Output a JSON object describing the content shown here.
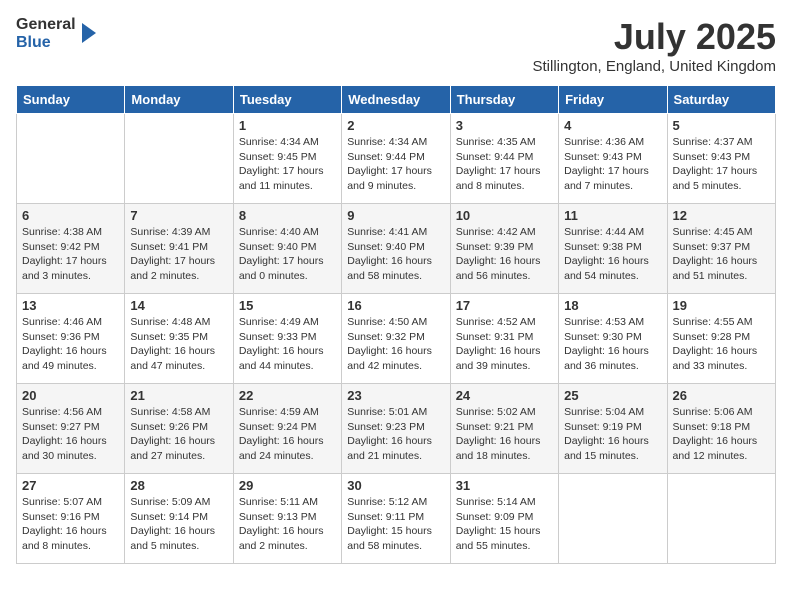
{
  "header": {
    "logo_general": "General",
    "logo_blue": "Blue",
    "month_title": "July 2025",
    "location": "Stillington, England, United Kingdom"
  },
  "days_of_week": [
    "Sunday",
    "Monday",
    "Tuesday",
    "Wednesday",
    "Thursday",
    "Friday",
    "Saturday"
  ],
  "weeks": [
    [
      {
        "day": "",
        "info": ""
      },
      {
        "day": "",
        "info": ""
      },
      {
        "day": "1",
        "info": "Sunrise: 4:34 AM\nSunset: 9:45 PM\nDaylight: 17 hours and 11 minutes."
      },
      {
        "day": "2",
        "info": "Sunrise: 4:34 AM\nSunset: 9:44 PM\nDaylight: 17 hours and 9 minutes."
      },
      {
        "day": "3",
        "info": "Sunrise: 4:35 AM\nSunset: 9:44 PM\nDaylight: 17 hours and 8 minutes."
      },
      {
        "day": "4",
        "info": "Sunrise: 4:36 AM\nSunset: 9:43 PM\nDaylight: 17 hours and 7 minutes."
      },
      {
        "day": "5",
        "info": "Sunrise: 4:37 AM\nSunset: 9:43 PM\nDaylight: 17 hours and 5 minutes."
      }
    ],
    [
      {
        "day": "6",
        "info": "Sunrise: 4:38 AM\nSunset: 9:42 PM\nDaylight: 17 hours and 3 minutes."
      },
      {
        "day": "7",
        "info": "Sunrise: 4:39 AM\nSunset: 9:41 PM\nDaylight: 17 hours and 2 minutes."
      },
      {
        "day": "8",
        "info": "Sunrise: 4:40 AM\nSunset: 9:40 PM\nDaylight: 17 hours and 0 minutes."
      },
      {
        "day": "9",
        "info": "Sunrise: 4:41 AM\nSunset: 9:40 PM\nDaylight: 16 hours and 58 minutes."
      },
      {
        "day": "10",
        "info": "Sunrise: 4:42 AM\nSunset: 9:39 PM\nDaylight: 16 hours and 56 minutes."
      },
      {
        "day": "11",
        "info": "Sunrise: 4:44 AM\nSunset: 9:38 PM\nDaylight: 16 hours and 54 minutes."
      },
      {
        "day": "12",
        "info": "Sunrise: 4:45 AM\nSunset: 9:37 PM\nDaylight: 16 hours and 51 minutes."
      }
    ],
    [
      {
        "day": "13",
        "info": "Sunrise: 4:46 AM\nSunset: 9:36 PM\nDaylight: 16 hours and 49 minutes."
      },
      {
        "day": "14",
        "info": "Sunrise: 4:48 AM\nSunset: 9:35 PM\nDaylight: 16 hours and 47 minutes."
      },
      {
        "day": "15",
        "info": "Sunrise: 4:49 AM\nSunset: 9:33 PM\nDaylight: 16 hours and 44 minutes."
      },
      {
        "day": "16",
        "info": "Sunrise: 4:50 AM\nSunset: 9:32 PM\nDaylight: 16 hours and 42 minutes."
      },
      {
        "day": "17",
        "info": "Sunrise: 4:52 AM\nSunset: 9:31 PM\nDaylight: 16 hours and 39 minutes."
      },
      {
        "day": "18",
        "info": "Sunrise: 4:53 AM\nSunset: 9:30 PM\nDaylight: 16 hours and 36 minutes."
      },
      {
        "day": "19",
        "info": "Sunrise: 4:55 AM\nSunset: 9:28 PM\nDaylight: 16 hours and 33 minutes."
      }
    ],
    [
      {
        "day": "20",
        "info": "Sunrise: 4:56 AM\nSunset: 9:27 PM\nDaylight: 16 hours and 30 minutes."
      },
      {
        "day": "21",
        "info": "Sunrise: 4:58 AM\nSunset: 9:26 PM\nDaylight: 16 hours and 27 minutes."
      },
      {
        "day": "22",
        "info": "Sunrise: 4:59 AM\nSunset: 9:24 PM\nDaylight: 16 hours and 24 minutes."
      },
      {
        "day": "23",
        "info": "Sunrise: 5:01 AM\nSunset: 9:23 PM\nDaylight: 16 hours and 21 minutes."
      },
      {
        "day": "24",
        "info": "Sunrise: 5:02 AM\nSunset: 9:21 PM\nDaylight: 16 hours and 18 minutes."
      },
      {
        "day": "25",
        "info": "Sunrise: 5:04 AM\nSunset: 9:19 PM\nDaylight: 16 hours and 15 minutes."
      },
      {
        "day": "26",
        "info": "Sunrise: 5:06 AM\nSunset: 9:18 PM\nDaylight: 16 hours and 12 minutes."
      }
    ],
    [
      {
        "day": "27",
        "info": "Sunrise: 5:07 AM\nSunset: 9:16 PM\nDaylight: 16 hours and 8 minutes."
      },
      {
        "day": "28",
        "info": "Sunrise: 5:09 AM\nSunset: 9:14 PM\nDaylight: 16 hours and 5 minutes."
      },
      {
        "day": "29",
        "info": "Sunrise: 5:11 AM\nSunset: 9:13 PM\nDaylight: 16 hours and 2 minutes."
      },
      {
        "day": "30",
        "info": "Sunrise: 5:12 AM\nSunset: 9:11 PM\nDaylight: 15 hours and 58 minutes."
      },
      {
        "day": "31",
        "info": "Sunrise: 5:14 AM\nSunset: 9:09 PM\nDaylight: 15 hours and 55 minutes."
      },
      {
        "day": "",
        "info": ""
      },
      {
        "day": "",
        "info": ""
      }
    ]
  ]
}
